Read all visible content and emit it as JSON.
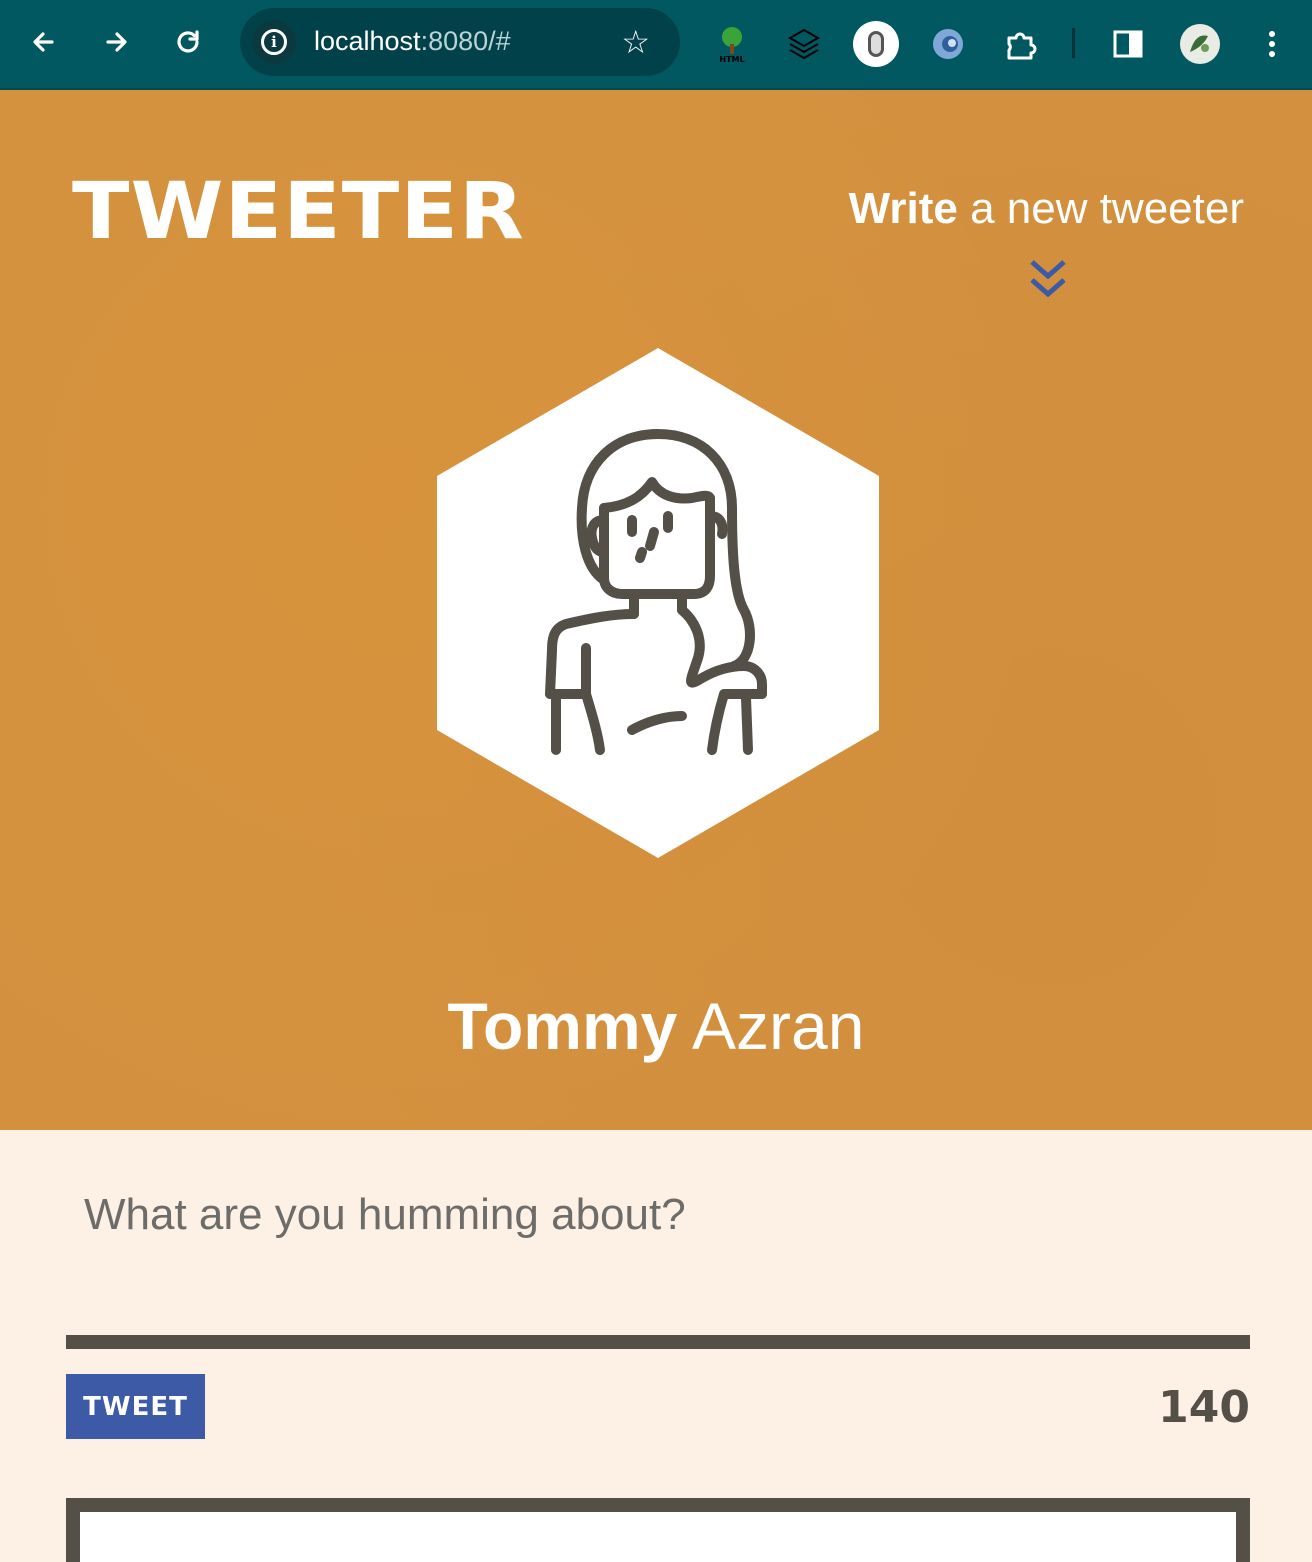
{
  "browser": {
    "url_host": "localhost",
    "url_rest": ":8080/#",
    "icons": [
      "back-arrow-icon",
      "forward-arrow-icon",
      "reload-icon",
      "site-info-icon",
      "bookmark-star-icon",
      "html-tree-extension-icon",
      "dark-extension-icon",
      "mouse-extension-icon",
      "blue-drop-extension-icon",
      "extensions-puzzle-icon",
      "side-panel-icon",
      "profile-avatar-icon",
      "more-menu-icon"
    ],
    "colors": {
      "toolbar": "#025861",
      "omnibox": "#01424a"
    }
  },
  "header": {
    "logo": "TWEETER",
    "write_bold": "Write",
    "write_rest": " a new tweeter",
    "chevron_icon": "double-chevron-down-icon"
  },
  "profile": {
    "first_name": "Tommy",
    "last_name": " Azran",
    "avatar_icon": "woman-avatar-icon"
  },
  "compose": {
    "placeholder": "What are you humming about?",
    "submit_label": "TWEET",
    "counter": "140"
  },
  "colors": {
    "hero_bg": "#d3913f",
    "compose_bg": "#fdf1e6",
    "accent": "#3c5aa6",
    "dark": "#545047"
  }
}
